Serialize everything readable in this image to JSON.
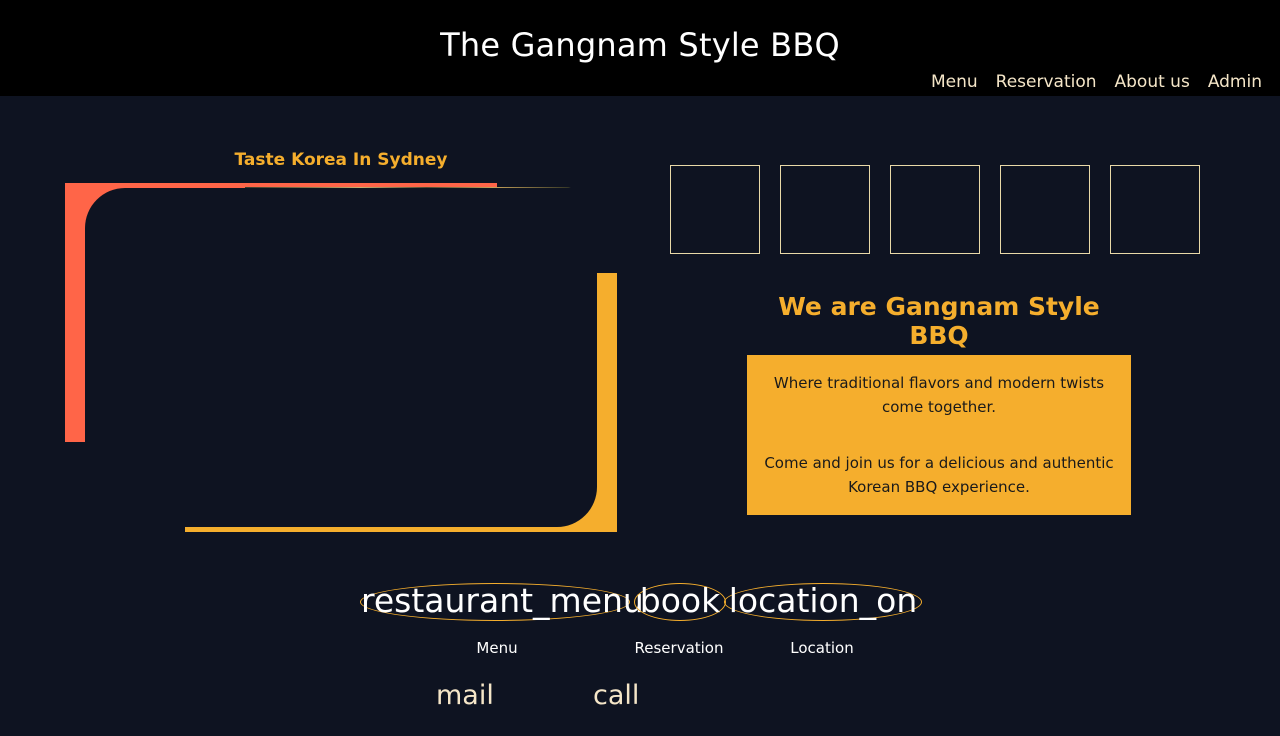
{
  "header": {
    "title": "The Gangnam Style BBQ",
    "nav": [
      "Menu",
      "Reservation",
      "About us",
      "Admin"
    ]
  },
  "hero": {
    "tagline": "Taste Korea In Sydney"
  },
  "about": {
    "title": "We are Gangnam Style BBQ",
    "paragraph1": "Where traditional flavors and modern twists come together.",
    "paragraph2": "Come and join us for a delicious and authentic Korean BBQ experience."
  },
  "quick_links": [
    {
      "icon": "restaurant_menu",
      "label": "Menu"
    },
    {
      "icon": "book",
      "label": "Reservation"
    },
    {
      "icon": "location_on",
      "label": "Location"
    }
  ],
  "contact": {
    "mail_icon": "mail",
    "call_icon": "call"
  },
  "colors": {
    "background": "#0e1321",
    "header": "#000000",
    "accent_orange": "#f5ae2d",
    "accent_red": "#ff6548",
    "nav_text": "#f5e6c8"
  }
}
